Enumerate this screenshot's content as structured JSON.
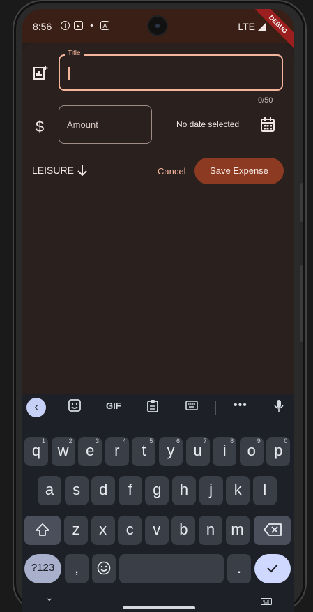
{
  "status_bar": {
    "time": "8:56",
    "network": "LTE",
    "debug_banner": "DEBUG"
  },
  "form": {
    "title_label": "Title",
    "title_value": "",
    "title_counter": "0/50",
    "amount_placeholder": "Amount",
    "date_text": "No date selected",
    "category": "LEISURE",
    "cancel_label": "Cancel",
    "save_label": "Save Expense"
  },
  "keyboard": {
    "toolbar": {
      "gif": "GIF"
    },
    "row1": [
      {
        "k": "q",
        "h": "1"
      },
      {
        "k": "w",
        "h": "2"
      },
      {
        "k": "e",
        "h": "3"
      },
      {
        "k": "r",
        "h": "4"
      },
      {
        "k": "t",
        "h": "5"
      },
      {
        "k": "y",
        "h": "6"
      },
      {
        "k": "u",
        "h": "7"
      },
      {
        "k": "i",
        "h": "8"
      },
      {
        "k": "o",
        "h": "9"
      },
      {
        "k": "p",
        "h": "0"
      }
    ],
    "row2": [
      "a",
      "s",
      "d",
      "f",
      "g",
      "h",
      "j",
      "k",
      "l"
    ],
    "row3": [
      "z",
      "x",
      "c",
      "v",
      "b",
      "n",
      "m"
    ],
    "symbols_label": "?123",
    "comma": ",",
    "period": "."
  }
}
